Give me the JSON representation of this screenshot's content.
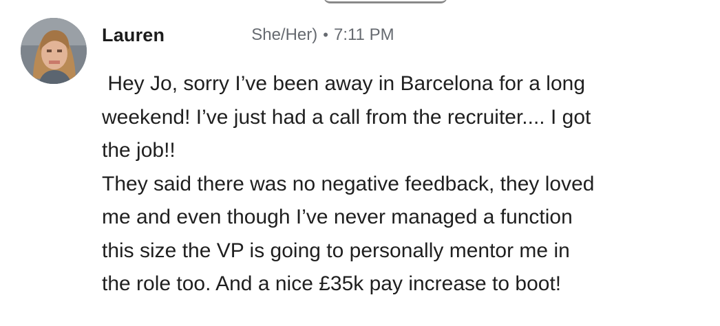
{
  "message": {
    "author": "Lauren",
    "pronouns": "She/Her)",
    "separator": "•",
    "timestamp": "7:11 PM",
    "avatar_icon": "user-avatar-photo",
    "lines": [
      " Hey Jo, sorry I’ve been away in Barcelona for a long",
      "weekend! I’ve just had a call from the recruiter.... I got",
      "the job!!",
      "They said there was no negative feedback, they loved",
      "me and even though I’ve never managed a function",
      "this size the VP is going to personally mentor me in",
      "the role too. And a nice £35k pay increase to boot!"
    ]
  },
  "colors": {
    "text": "#1f1f1f",
    "meta": "#666a70",
    "background": "#ffffff"
  }
}
